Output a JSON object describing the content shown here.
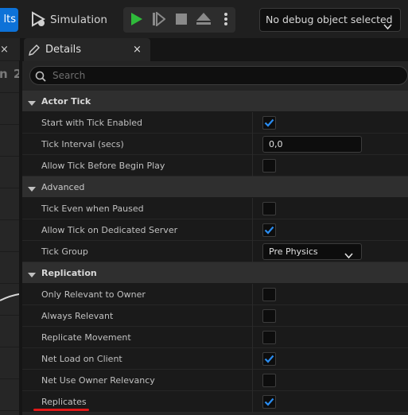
{
  "toolbar": {
    "results_label": "lts",
    "simulation_label": "Simulation",
    "play_icon_color": "#2fbb3b",
    "debug_select_value": "No debug object selected"
  },
  "tabs": {
    "left_close": "×",
    "details_label": "Details",
    "details_close": "×"
  },
  "left_strip_text": "n 2",
  "search": {
    "placeholder": "Search"
  },
  "details": {
    "categories": [
      {
        "label": "Actor Tick",
        "bold": true,
        "properties": [
          {
            "name": "Start with Tick Enabled",
            "type": "checkbox",
            "checked": true
          },
          {
            "name": "Tick Interval (secs)",
            "type": "number",
            "value": "0,0"
          },
          {
            "name": "Allow Tick Before Begin Play",
            "type": "checkbox",
            "checked": false
          }
        ]
      },
      {
        "label": "Advanced",
        "bold": false,
        "properties": [
          {
            "name": "Tick Even when Paused",
            "type": "checkbox",
            "checked": false
          },
          {
            "name": "Allow Tick on Dedicated Server",
            "type": "checkbox",
            "checked": true
          },
          {
            "name": "Tick Group",
            "type": "combo",
            "value": "Pre Physics"
          }
        ]
      },
      {
        "label": "Replication",
        "bold": true,
        "properties": [
          {
            "name": "Only Relevant to Owner",
            "type": "checkbox",
            "checked": false
          },
          {
            "name": "Always Relevant",
            "type": "checkbox",
            "checked": false
          },
          {
            "name": "Replicate Movement",
            "type": "checkbox",
            "checked": false
          },
          {
            "name": "Net Load on Client",
            "type": "checkbox",
            "checked": true
          },
          {
            "name": "Net Use Owner Relevancy",
            "type": "checkbox",
            "checked": false
          },
          {
            "name": "Replicates",
            "type": "checkbox",
            "checked": true
          }
        ]
      }
    ]
  },
  "colors": {
    "accent": "#0d72d8",
    "check": "#2a8cf0",
    "highlight_underline": "#e01818"
  }
}
